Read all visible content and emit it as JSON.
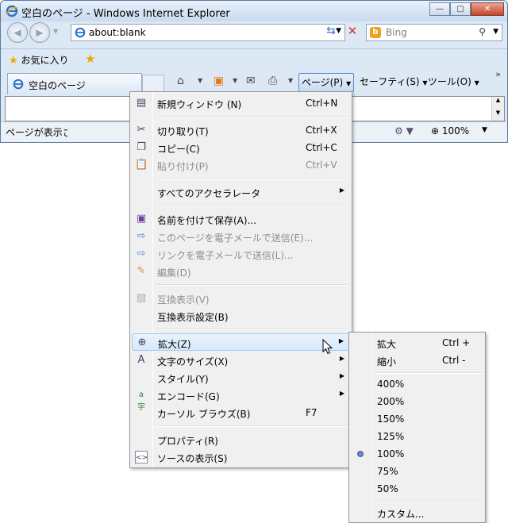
{
  "window": {
    "title": "空白のページ - Windows Internet Explorer",
    "minimize": "—",
    "maximize": "▢",
    "close": "✕"
  },
  "nav": {
    "back": "◀",
    "forward": "▶",
    "address": "about:blank",
    "search_placeholder": "Bing",
    "search_logo": "b"
  },
  "favorites": {
    "label": "お気に入り"
  },
  "tab": {
    "label": "空白のページ"
  },
  "commandbar": {
    "page": "ページ(P)",
    "safety": "セーフティ(S)",
    "tools": "ツール(O)"
  },
  "status": {
    "text": "ページが表示さ",
    "zoom": "100%"
  },
  "menu": {
    "items": [
      {
        "label": "新規ウィンドウ (N)",
        "shortcut": "Ctrl+N",
        "icon": "new-window-icon"
      },
      {
        "label": "切り取り(T)",
        "shortcut": "Ctrl+X",
        "icon": "scissors-icon"
      },
      {
        "label": "コピー(C)",
        "shortcut": "Ctrl+C",
        "icon": "copy-icon"
      },
      {
        "label": "貼り付け(P)",
        "shortcut": "Ctrl+V",
        "icon": "paste-icon"
      },
      {
        "label": "すべてのアクセラレータ",
        "shortcut": "",
        "icon": ""
      },
      {
        "label": "名前を付けて保存(A)...",
        "shortcut": "",
        "icon": "save-icon"
      },
      {
        "label": "このページを電子メールで送信(E)...",
        "shortcut": "",
        "icon": "mail-page-icon"
      },
      {
        "label": "リンクを電子メールで送信(L)...",
        "shortcut": "",
        "icon": "mail-link-icon"
      },
      {
        "label": "編集(D)",
        "shortcut": "",
        "icon": "pencil-icon"
      },
      {
        "label": "互換表示(V)",
        "shortcut": "",
        "icon": "compat-icon"
      },
      {
        "label": "互換表示設定(B)",
        "shortcut": "",
        "icon": ""
      },
      {
        "label": "拡大(Z)",
        "shortcut": "",
        "icon": "zoom-icon"
      },
      {
        "label": "文字のサイズ(X)",
        "shortcut": "",
        "icon": "text-size-icon"
      },
      {
        "label": "スタイル(Y)",
        "shortcut": "",
        "icon": ""
      },
      {
        "label": "エンコード(G)",
        "shortcut": "",
        "icon": "encoding-icon"
      },
      {
        "label": "カーソル ブラウズ(B)",
        "shortcut": "F7",
        "icon": ""
      },
      {
        "label": "プロパティ(R)",
        "shortcut": "",
        "icon": ""
      },
      {
        "label": "ソースの表示(S)",
        "shortcut": "",
        "icon": "source-icon"
      }
    ]
  },
  "zoom_submenu": {
    "zoom_in": "拡大",
    "zoom_in_shortcut": "Ctrl +",
    "zoom_out": "縮小",
    "zoom_out_shortcut": "Ctrl -",
    "levels": [
      "400%",
      "200%",
      "150%",
      "125%",
      "100%",
      "75%",
      "50%"
    ],
    "selected": "100%",
    "custom": "カスタム..."
  }
}
